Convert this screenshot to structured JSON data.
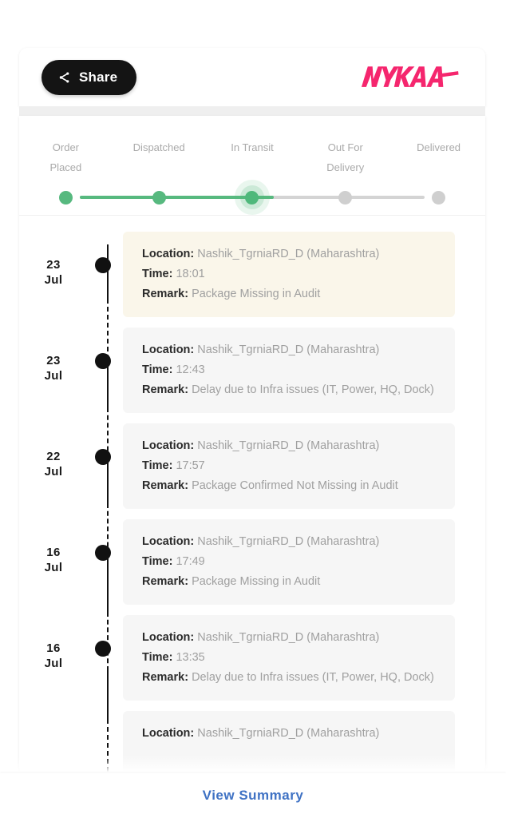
{
  "header": {
    "share_label": "Share",
    "share_icon": "share-icon",
    "brand_logo": "nykaa-logo",
    "brand_name": "NYKAA",
    "brand_color": "#f5266e"
  },
  "tracker": {
    "active_index": 2,
    "accent_color": "#57b97f",
    "inactive_color": "#cfcfcf",
    "steps": [
      {
        "label": "Order\nPlaced",
        "state": "done"
      },
      {
        "label": "Dispatched",
        "state": "done"
      },
      {
        "label": "In Transit",
        "state": "active"
      },
      {
        "label": "Out For\nDelivery",
        "state": "pending"
      },
      {
        "label": "Delivered",
        "state": "pending"
      }
    ]
  },
  "timeline": {
    "labels": {
      "location": "Location:",
      "time": "Time:",
      "remark": "Remark:"
    },
    "events": [
      {
        "day": "23",
        "month": "Jul",
        "location": "Nashik_TgrniaRD_D (Maharashtra)",
        "time": "18:01",
        "remark": "Package Missing in Audit",
        "highlight": true
      },
      {
        "day": "23",
        "month": "Jul",
        "location": "Nashik_TgrniaRD_D (Maharashtra)",
        "time": "12:43",
        "remark": "Delay due to Infra issues (IT, Power, HQ, Dock)",
        "highlight": false
      },
      {
        "day": "22",
        "month": "Jul",
        "location": "Nashik_TgrniaRD_D (Maharashtra)",
        "time": "17:57",
        "remark": "Package Confirmed Not Missing in Audit",
        "highlight": false
      },
      {
        "day": "16",
        "month": "Jul",
        "location": "Nashik_TgrniaRD_D (Maharashtra)",
        "time": "17:49",
        "remark": "Package Missing in Audit",
        "highlight": false
      },
      {
        "day": "16",
        "month": "Jul",
        "location": "Nashik_TgrniaRD_D (Maharashtra)",
        "time": "13:35",
        "remark": "Delay due to Infra issues (IT, Power, HQ, Dock)",
        "highlight": false
      },
      {
        "day": "",
        "month": "",
        "location": "Nashik_TgrniaRD_D (Maharashtra)",
        "time": "",
        "remark": "",
        "highlight": false
      }
    ]
  },
  "footer": {
    "view_summary_label": "View Summary",
    "link_color": "#3f72c4"
  }
}
